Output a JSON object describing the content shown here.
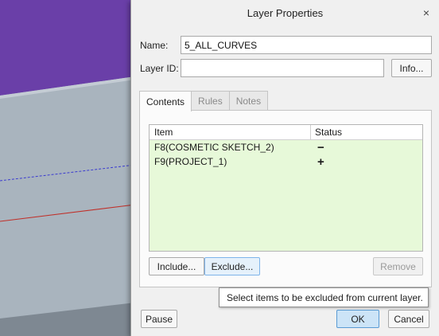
{
  "dialog": {
    "title": "Layer Properties",
    "close_glyph": "×",
    "name_label": "Name:",
    "name_value": "5_ALL_CURVES",
    "layer_id_label": "Layer ID:",
    "layer_id_value": "",
    "info_button": "Info..."
  },
  "tabs": [
    {
      "label": "Contents",
      "active": true
    },
    {
      "label": "Rules",
      "active": false
    },
    {
      "label": "Notes",
      "active": false
    }
  ],
  "items_table": {
    "columns": [
      "Item",
      "Status"
    ],
    "rows": [
      {
        "item": "F8(COSMETIC SKETCH_2)",
        "status": "−"
      },
      {
        "item": "F9(PROJECT_1)",
        "status": "+"
      }
    ]
  },
  "list_buttons": {
    "include": "Include...",
    "exclude": "Exclude...",
    "remove": "Remove"
  },
  "tooltip": "Select items to be excluded from current layer.",
  "footer": {
    "pause": "Pause",
    "ok": "OK",
    "cancel": "Cancel"
  },
  "colors": {
    "viewport_background": "#6a3fa8",
    "list_background": "#e7f9d9",
    "ok_button": "#cce4f7"
  }
}
